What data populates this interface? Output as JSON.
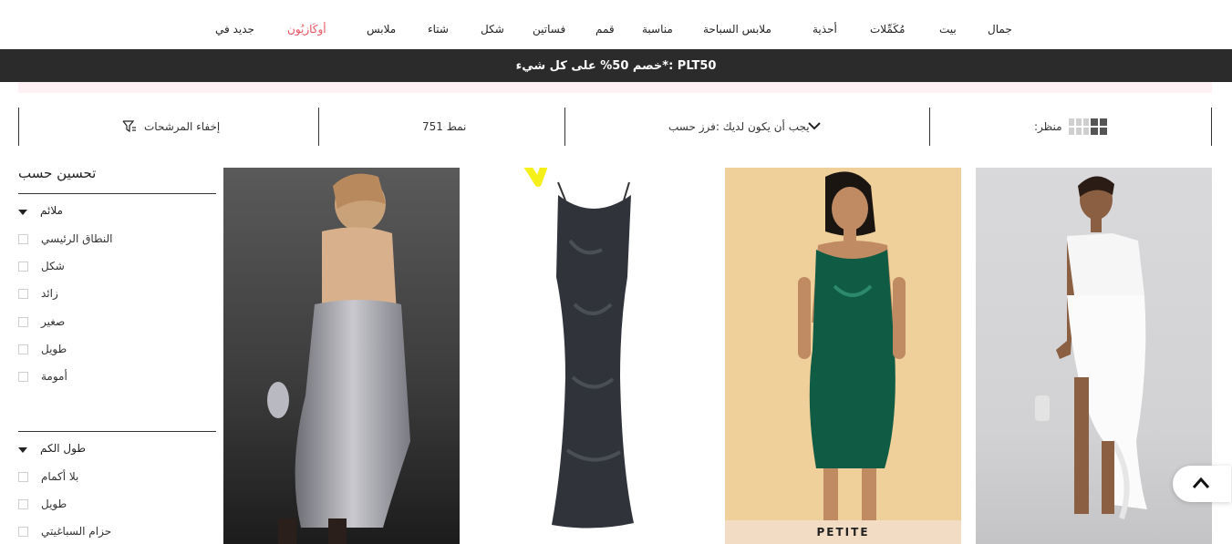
{
  "nav": {
    "items": [
      {
        "label": "جمال"
      },
      {
        "label": "بيت"
      },
      {
        "label": "مُكَمِّلات"
      },
      {
        "label": "أحذية"
      },
      {
        "label": "ملابس السباحة"
      },
      {
        "label": "مناسبة"
      },
      {
        "label": "قمم"
      },
      {
        "label": "فساتين"
      },
      {
        "label": "شكل"
      },
      {
        "label": "شتاء"
      },
      {
        "label": "ملابس"
      },
      {
        "label": "أوكَازيُون"
      },
      {
        "label": "جديد في"
      }
    ],
    "highlight_color": "#e8525f"
  },
  "promo": {
    "text": "PLT50 :*خصم 50% على كل شيء"
  },
  "toolbar": {
    "view_label": ":منظر",
    "sort_label": "يجب أن يكون لديك :فرز حسب",
    "count_label": "نمط 751",
    "hide_filters_label": "إخفاء المرشحات"
  },
  "sidebar": {
    "title": "تحسين حسب",
    "groups": [
      {
        "label": "ملائم",
        "items": [
          "النطاق الرئيسي",
          "شكل",
          "زائد",
          "صغير",
          "طويل",
          "أمومة"
        ]
      },
      {
        "label": "طول الكم",
        "items": [
          "بلا أكمام",
          "طويل",
          "حزام السباغيتي"
        ]
      }
    ]
  },
  "products": [
    {
      "name": "white-one-shoulder-ruffle-dress",
      "tag": ""
    },
    {
      "name": "emerald-satin-cowl-midi-dress",
      "tag": "PETITE"
    },
    {
      "name": "black-lace-cowl-maxi-dress",
      "tag": ""
    },
    {
      "name": "silver-sequin-backless-maxi-dress",
      "tag": ""
    }
  ],
  "colors": {
    "promo_bg": "#2b2b2b",
    "accent_pink": "#e8525f",
    "annotation": "#f5ef1a"
  }
}
